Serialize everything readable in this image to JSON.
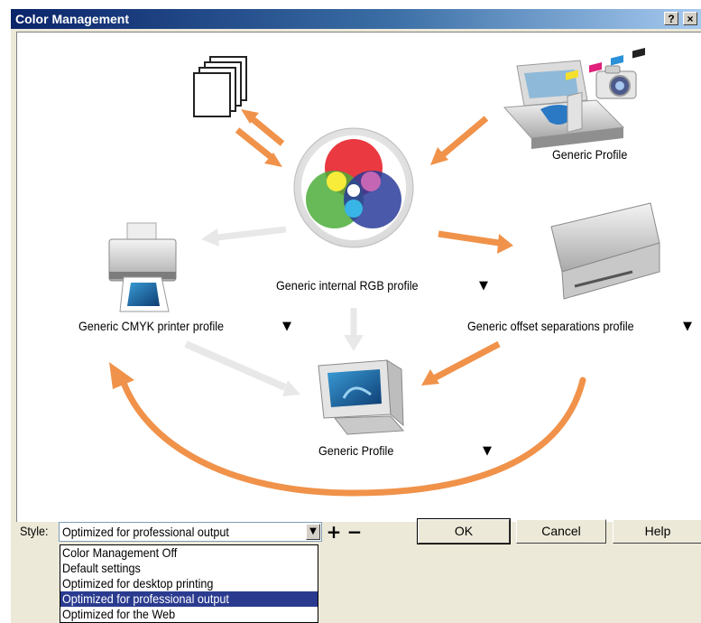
{
  "window": {
    "title": "Color Management",
    "help_glyph": "?",
    "close_glyph": "×"
  },
  "diagram": {
    "internal_profile": "Generic internal RGB profile",
    "scanner_profile": "Generic Profile",
    "printer_profile": "Generic CMYK printer profile",
    "offset_profile": "Generic offset separations profile",
    "monitor_profile": "Generic Profile",
    "dropdown_glyph": "▼"
  },
  "toolbar": {
    "style_label": "Style:",
    "style_value": "Optimized for professional output",
    "add_glyph": "+",
    "remove_glyph": "−",
    "ok_label": "OK",
    "cancel_label": "Cancel",
    "help_label": "Help"
  },
  "style_options": [
    "Color Management Off",
    "Default settings",
    "Optimized for desktop printing",
    "Optimized for professional output",
    "Optimized for the Web"
  ],
  "colors": {
    "orange_arrow": "#f0924a",
    "grey_arrow": "#e8e8e8",
    "titlebar": "#0a246a",
    "list_selection": "#2a3b8f"
  }
}
